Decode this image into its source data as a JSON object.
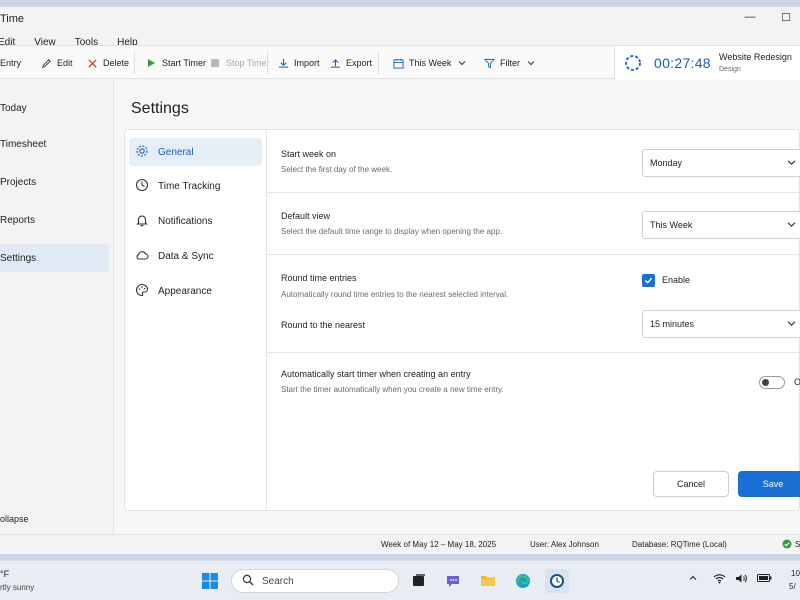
{
  "window": {
    "title": "Time",
    "maximize_glyph": "☐",
    "minimize_glyph": "—"
  },
  "menubar": [
    "Edit",
    "View",
    "Tools",
    "Help"
  ],
  "toolbar": {
    "new_entry": "Entry",
    "edit": "Edit",
    "delete": "Delete",
    "start_timer": "Start Timer",
    "stop_timer": "Stop Timer",
    "import": "Import",
    "export": "Export",
    "range": "This Week",
    "filter": "Filter",
    "timer_value": "00:27:48",
    "project_name": "Website Redesign",
    "project_sub": "Design"
  },
  "leftnav": {
    "items": [
      "Today",
      "Timesheet",
      "Projects",
      "Reports",
      "Settings"
    ],
    "active": "Settings",
    "collapse": "ollapse"
  },
  "settings": {
    "title": "Settings",
    "subnav": [
      "General",
      "Time Tracking",
      "Notifications",
      "Data & Sync",
      "Appearance"
    ],
    "start_week_label": "Start week on",
    "start_week_desc": "Select the first day of the week.",
    "start_week_value": "Monday",
    "default_view_label": "Default view",
    "default_view_desc": "Select the default time range to display when opening the app.",
    "default_view_value": "This Week",
    "round_label": "Round time entries",
    "round_desc": "Automatically round time entries to the nearest selected interval.",
    "round_checkbox": "Enable",
    "round_nearest_label": "Round to the nearest",
    "round_nearest_value": "15 minutes",
    "autostart_label": "Automatically start timer when creating an entry",
    "autostart_desc": "Start the timer automatically when you create a new time entry.",
    "autostart_toggle": "O",
    "cancel": "Cancel",
    "save": "Save"
  },
  "statusbar": {
    "week": "Week of May 12 – May 18, 2025",
    "user": "User: Alex Johnson",
    "database": "Database: RQTime (Local)",
    "sync": "S"
  },
  "taskbar": {
    "weather_temp": "°F",
    "weather_desc": "rtly sunny",
    "search_placeholder": "Search",
    "clock_line1": "10",
    "clock_line2": "5/"
  },
  "colors": {
    "accent": "#1a6fd6",
    "active_nav_bg": "#e1e9f4",
    "timer_text": "#1a5fb4"
  }
}
